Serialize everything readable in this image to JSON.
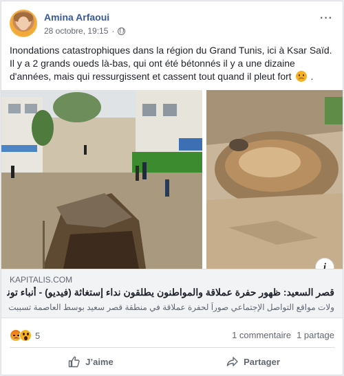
{
  "post": {
    "author": "Amina Arfaoui",
    "timestamp": "28 octobre, 19:15",
    "separator": "·",
    "audience_icon": "globe-icon",
    "more_icon": "more-options-icon",
    "text_main": "Inondations catastrophiques dans la région du Grand Tunis, ici à Ksar Saïd. Il y a 2 grands oueds là-bas, qui ont été bétonnés il y a une dizaine d'années, mais qui ressurgissent et cassent tout quand il pleut fort",
    "text_end": ".",
    "text_emoji": "disappointed-face-emoji"
  },
  "link": {
    "domain": "KAPITALIS.COM",
    "title": "قصر السعيد: ظهور حفرة عملاقة والمواطنون يطلقون نداء إستغاثة (فيديو) - أنباء تونس",
    "description": "ولات مواقع التواصل الإجتماعي صوراً لحفرة عملاقة في منطقة قصر سعيد بوسط العاصمة تسببت في",
    "info_icon": "i"
  },
  "stats": {
    "reaction_count": "5",
    "reactions": [
      "angry-reaction-icon",
      "wow-reaction-icon"
    ],
    "comments": "1 commentaire",
    "shares": "1 partage"
  },
  "actions": {
    "like": "J’aime",
    "share": "Partager"
  },
  "colors": {
    "name_blue": "#385898",
    "muted": "#606770",
    "card_bg": "#ffffff",
    "page_bg": "#e9ebee",
    "link_bg": "#f2f3f5"
  }
}
